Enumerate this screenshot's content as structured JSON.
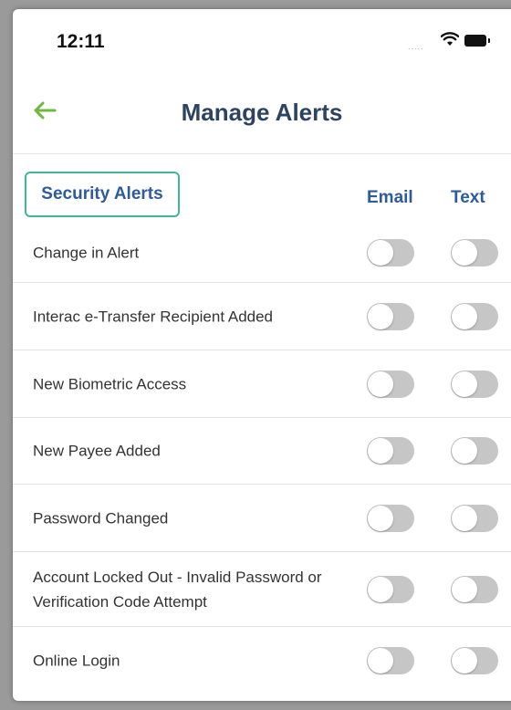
{
  "status_bar": {
    "time": "12:11",
    "signal": "....."
  },
  "header": {
    "title": "Manage Alerts"
  },
  "section": {
    "title": "Security Alerts",
    "col_email": "Email",
    "col_text": "Text"
  },
  "alerts": [
    {
      "label": "Change in Alert",
      "email_on": false,
      "text_on": false
    },
    {
      "label": "Interac e-Transfer Recipient Added",
      "email_on": false,
      "text_on": false
    },
    {
      "label": "New Biometric Access",
      "email_on": false,
      "text_on": false
    },
    {
      "label": "New Payee Added",
      "email_on": false,
      "text_on": false
    },
    {
      "label": "Password Changed",
      "email_on": false,
      "text_on": false
    },
    {
      "label": "Account Locked Out - Invalid Password or Verification Code Attempt",
      "email_on": false,
      "text_on": false
    },
    {
      "label": "Online Login",
      "email_on": false,
      "text_on": false
    }
  ],
  "colors": {
    "accent": "#6fb83f",
    "title": "#2c4462",
    "link": "#2e5b9a",
    "highlight": "#3fb59e",
    "toggle_off": "#c6c6c6"
  }
}
